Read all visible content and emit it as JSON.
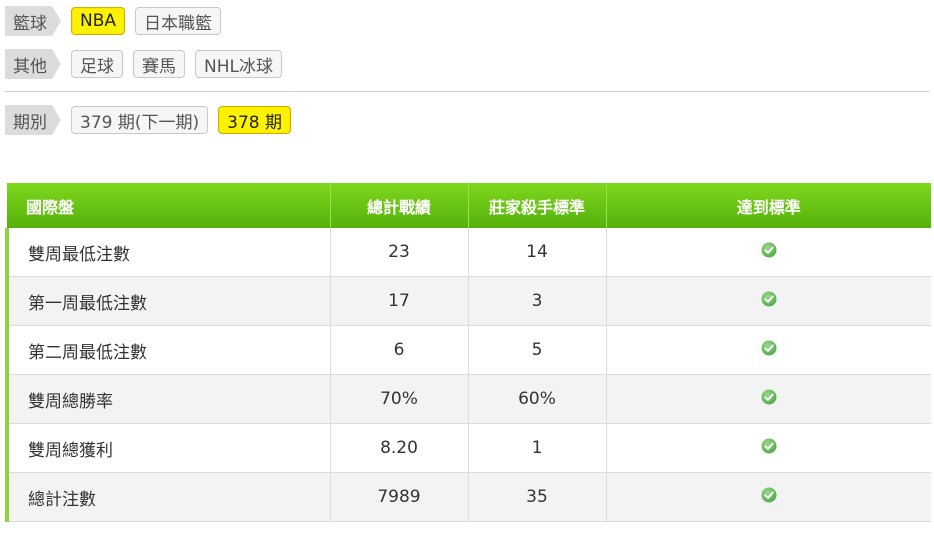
{
  "filters": {
    "basketball": {
      "label": "籃球",
      "options": [
        {
          "text": "NBA",
          "active": true
        },
        {
          "text": "日本職籃",
          "active": false
        }
      ]
    },
    "other": {
      "label": "其他",
      "options": [
        {
          "text": "足球",
          "active": false
        },
        {
          "text": "賽馬",
          "active": false
        },
        {
          "text": "NHL冰球",
          "active": false
        }
      ]
    },
    "period": {
      "label": "期別",
      "options": [
        {
          "text": "379 期(下一期)",
          "active": false
        },
        {
          "text": "378 期",
          "active": true
        }
      ]
    }
  },
  "table": {
    "headers": [
      "國際盤",
      "總計戰績",
      "莊家殺手標準",
      "達到標準"
    ],
    "rows": [
      {
        "name": "雙周最低注數",
        "record": "23",
        "standard": "14",
        "met": "check-icon"
      },
      {
        "name": "第一周最低注數",
        "record": "17",
        "standard": "3",
        "met": "check-icon"
      },
      {
        "name": "第二周最低注數",
        "record": "6",
        "standard": "5",
        "met": "check-icon"
      },
      {
        "name": "雙周總勝率",
        "record": "70%",
        "standard": "60%",
        "met": "check-icon"
      },
      {
        "name": "雙周總獲利",
        "record": "8.20",
        "standard": "1",
        "met": "check-icon"
      },
      {
        "name": "總計注數",
        "record": "7989",
        "standard": "35",
        "met": "check-icon"
      }
    ]
  },
  "colors": {
    "accent_green": "#6cc516",
    "active_yellow": "#fdf200",
    "check_green": "#5cb85c"
  }
}
